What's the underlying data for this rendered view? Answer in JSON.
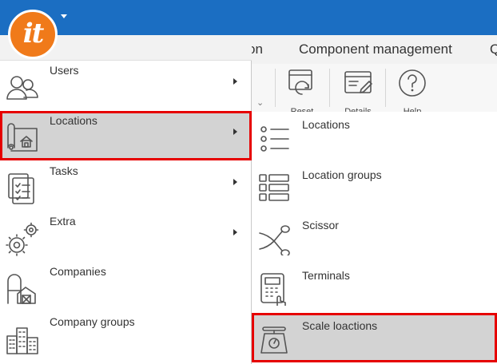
{
  "app": {
    "logo_text": "it"
  },
  "ribbon": {
    "tabs": [
      "on",
      "Component management",
      "Q"
    ],
    "buttons": [
      {
        "label": "Reset",
        "icon": "reset-icon"
      },
      {
        "label": "Details",
        "icon": "details-icon"
      },
      {
        "label": "Help",
        "icon": "help-icon"
      }
    ]
  },
  "menu": {
    "items": [
      {
        "label": "Users",
        "icon": "users-icon",
        "has_submenu": true
      },
      {
        "label": "Locations",
        "icon": "locations-map-icon",
        "has_submenu": true,
        "selected": true
      },
      {
        "label": "Tasks",
        "icon": "tasks-icon",
        "has_submenu": true
      },
      {
        "label": "Extra",
        "icon": "gears-icon",
        "has_submenu": true
      },
      {
        "label": "Companies",
        "icon": "companies-icon",
        "has_submenu": false
      },
      {
        "label": "Company groups",
        "icon": "company-groups-icon",
        "has_submenu": false
      }
    ]
  },
  "submenu": {
    "items": [
      {
        "label": "Locations",
        "icon": "list-icon"
      },
      {
        "label": "Location groups",
        "icon": "location-groups-icon"
      },
      {
        "label": "Scissor",
        "icon": "scissor-icon"
      },
      {
        "label": "Terminals",
        "icon": "terminal-icon"
      },
      {
        "label": "Scale loactions",
        "icon": "scale-icon",
        "selected": true
      }
    ]
  },
  "colors": {
    "titlebar": "#1b6ec2",
    "logo": "#f07a1a",
    "highlight_border": "#e60000",
    "selected_bg": "#d3d3d3"
  }
}
